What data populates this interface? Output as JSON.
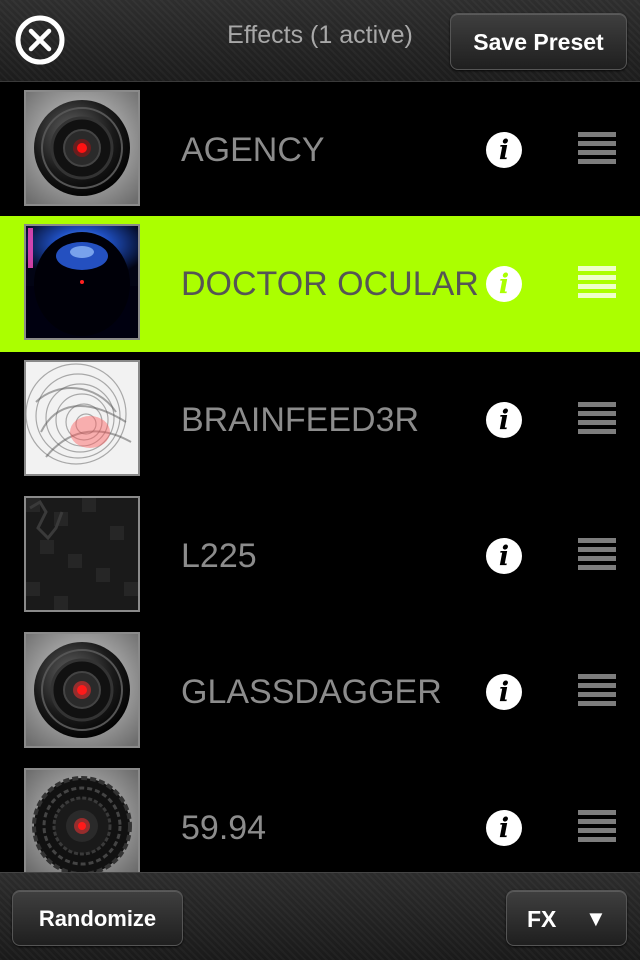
{
  "header": {
    "title": "Effects (1 active)",
    "save_label": "Save Preset",
    "close_icon": "close-circle-icon"
  },
  "effects": [
    {
      "name": "AGENCY",
      "active": false,
      "thumbnail": "lens-icon"
    },
    {
      "name": "DOCTOR OCULAR",
      "active": true,
      "thumbnail": "blue-lens-icon"
    },
    {
      "name": "BRAINFEED3R",
      "active": false,
      "thumbnail": "swirl-pattern-icon"
    },
    {
      "name": "L225",
      "active": false,
      "thumbnail": "dark-texture-icon"
    },
    {
      "name": "GLASSDAGGER",
      "active": false,
      "thumbnail": "lens-icon"
    },
    {
      "name": "59.94",
      "active": false,
      "thumbnail": "pixelated-lens-icon"
    }
  ],
  "info_glyph": "i",
  "footer": {
    "randomize_label": "Randomize",
    "fx_label": "FX",
    "fx_arrow": "▼"
  },
  "colors": {
    "active_row": "#abff00",
    "label_gray": "#8c8c8c",
    "background": "#000000"
  }
}
